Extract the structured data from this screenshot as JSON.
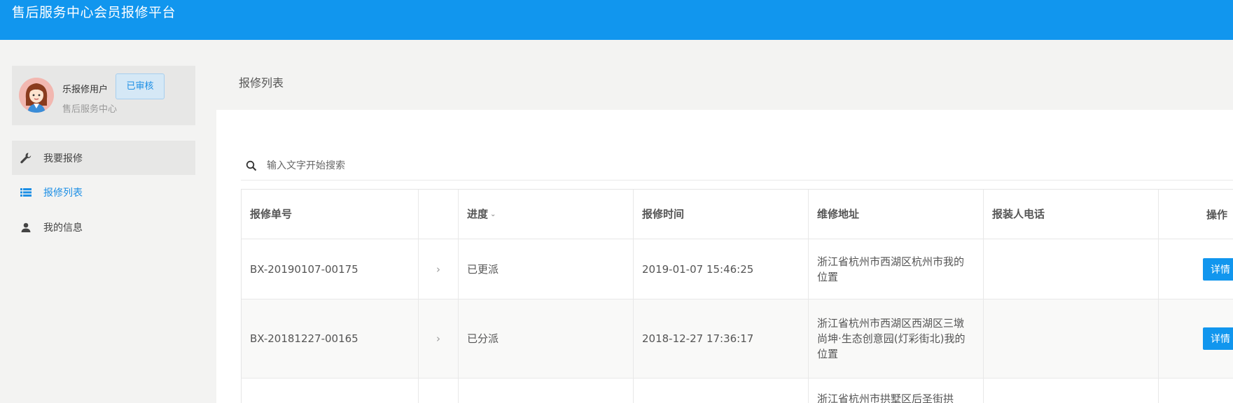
{
  "app": {
    "title": "售后服务中心会员报修平台"
  },
  "user": {
    "name": "乐报修用户",
    "status": "已审核",
    "org": "售后服务中心"
  },
  "nav": {
    "items": [
      {
        "label": "我要报修",
        "icon": "wrench-icon"
      },
      {
        "label": "报修列表",
        "icon": "list-icon"
      },
      {
        "label": "我的信息",
        "icon": "person-icon"
      }
    ]
  },
  "page": {
    "title": "报修列表"
  },
  "search": {
    "placeholder": "输入文字开始搜索",
    "value": ""
  },
  "table": {
    "columns": [
      "报修单号",
      "",
      "进度",
      "报修时间",
      "维修地址",
      "报装人电话",
      "操作"
    ],
    "sort_indicator": "⌄",
    "rows": [
      {
        "id": "BX-20190107-00175",
        "expand": "›",
        "progress": "已更派",
        "time": "2019-01-07 15:46:25",
        "address": "浙江省杭州市西湖区杭州市我的位置",
        "phone": "",
        "action": "详情"
      },
      {
        "id": "BX-20181227-00165",
        "expand": "›",
        "progress": "已分派",
        "time": "2018-12-27 17:36:17",
        "address": "浙江省杭州市西湖区西湖区三墩尚坤·生态创意园(灯彩街北)我的位置",
        "phone": "",
        "action": "详情"
      },
      {
        "id": "",
        "expand": "",
        "progress": "",
        "time": "",
        "address": "浙江省杭州市拱墅区后圣街拱",
        "phone": "",
        "action": ""
      }
    ]
  },
  "colors": {
    "brand": "#1196ee",
    "accent_text": "#1d8fe5",
    "background": "#f3f3f2"
  }
}
